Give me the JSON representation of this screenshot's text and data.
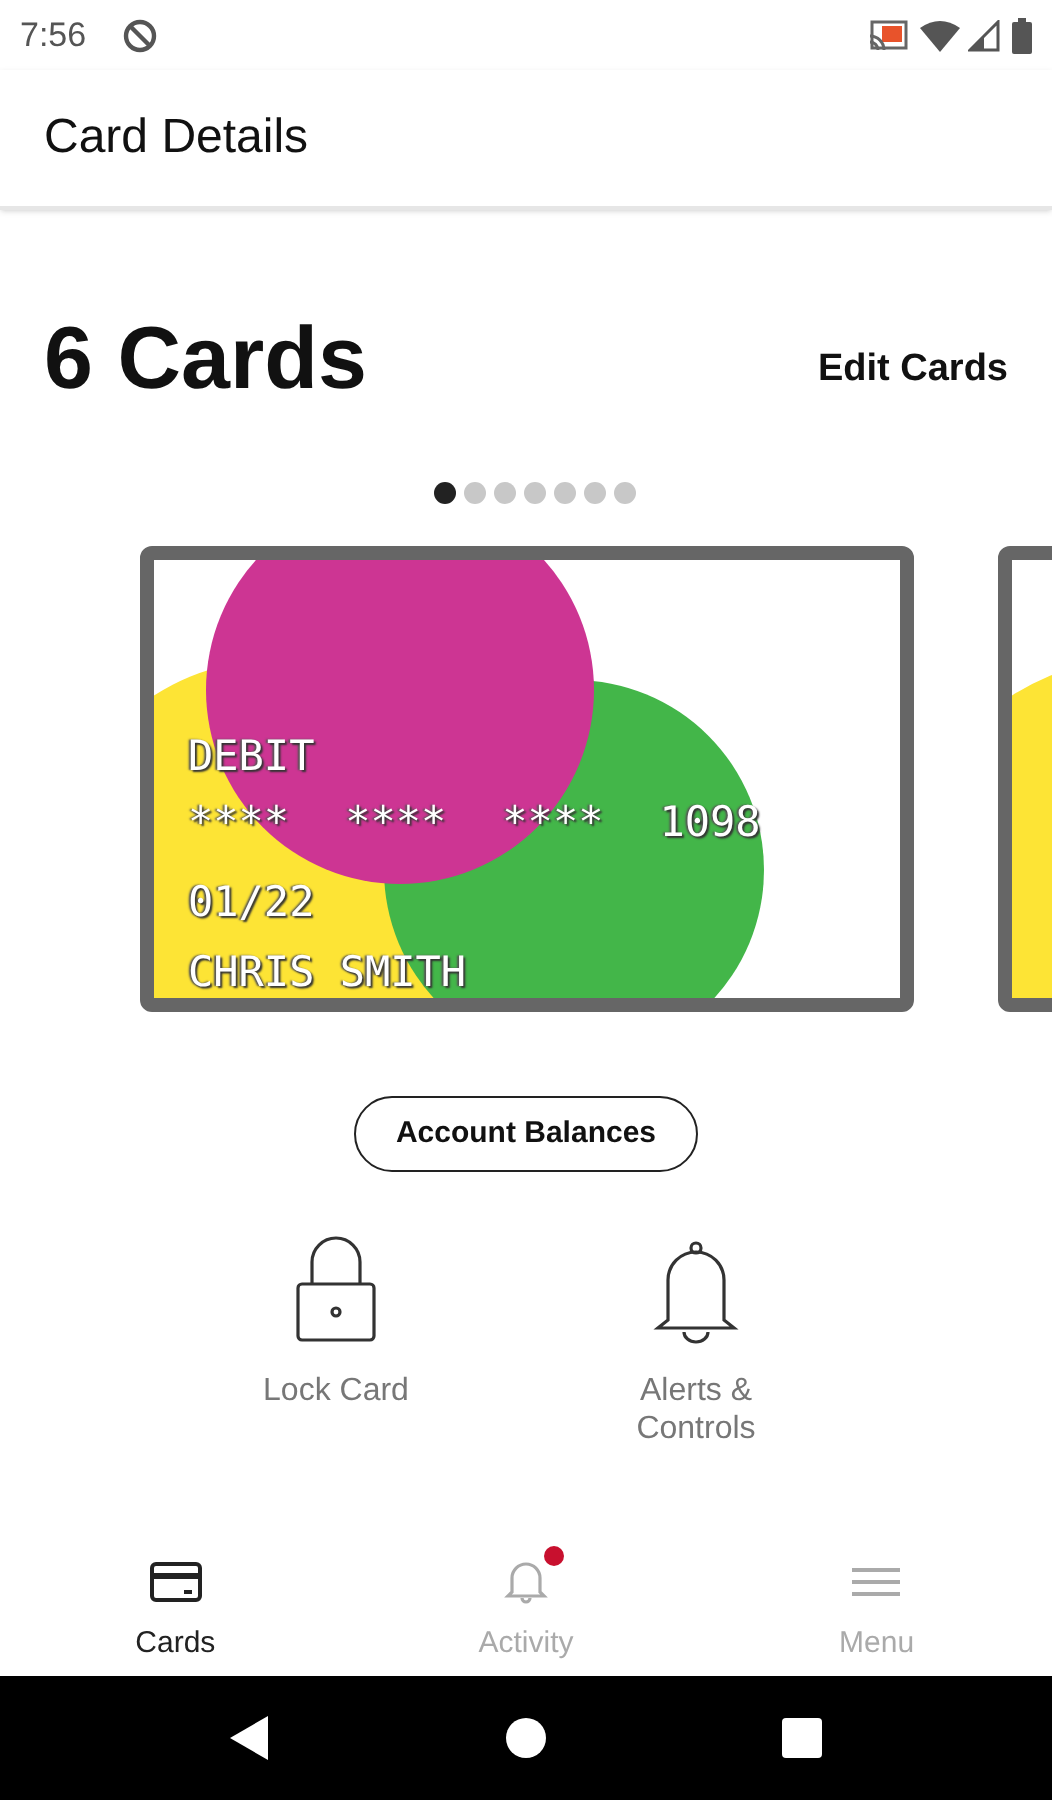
{
  "status_bar": {
    "time": "7:56"
  },
  "app_bar": {
    "title": "Card Details"
  },
  "header": {
    "title": "6 Cards",
    "action": "Edit Cards"
  },
  "pager": [
    {
      "selected": true
    },
    {
      "selected": false
    },
    {
      "selected": false
    },
    {
      "selected": false
    },
    {
      "selected": false
    },
    {
      "selected": false
    },
    {
      "selected": false
    }
  ],
  "card": {
    "type": "DEBIT",
    "number_groups": [
      "****",
      "****",
      "****",
      "1098"
    ],
    "expiry": "01/22",
    "holder": "CHRIS SMITH"
  },
  "account_button": "Account Balances",
  "actions": [
    {
      "kind": "lock",
      "label": "Lock Card"
    },
    {
      "kind": "bell",
      "label": "Alerts & Controls"
    }
  ],
  "bottom_nav": [
    {
      "kind": "card",
      "label": "Cards",
      "selected": true,
      "badge": false
    },
    {
      "kind": "bell",
      "label": "Activity",
      "selected": false,
      "badge": true
    },
    {
      "kind": "menu",
      "label": "Menu",
      "selected": false,
      "badge": false
    }
  ]
}
